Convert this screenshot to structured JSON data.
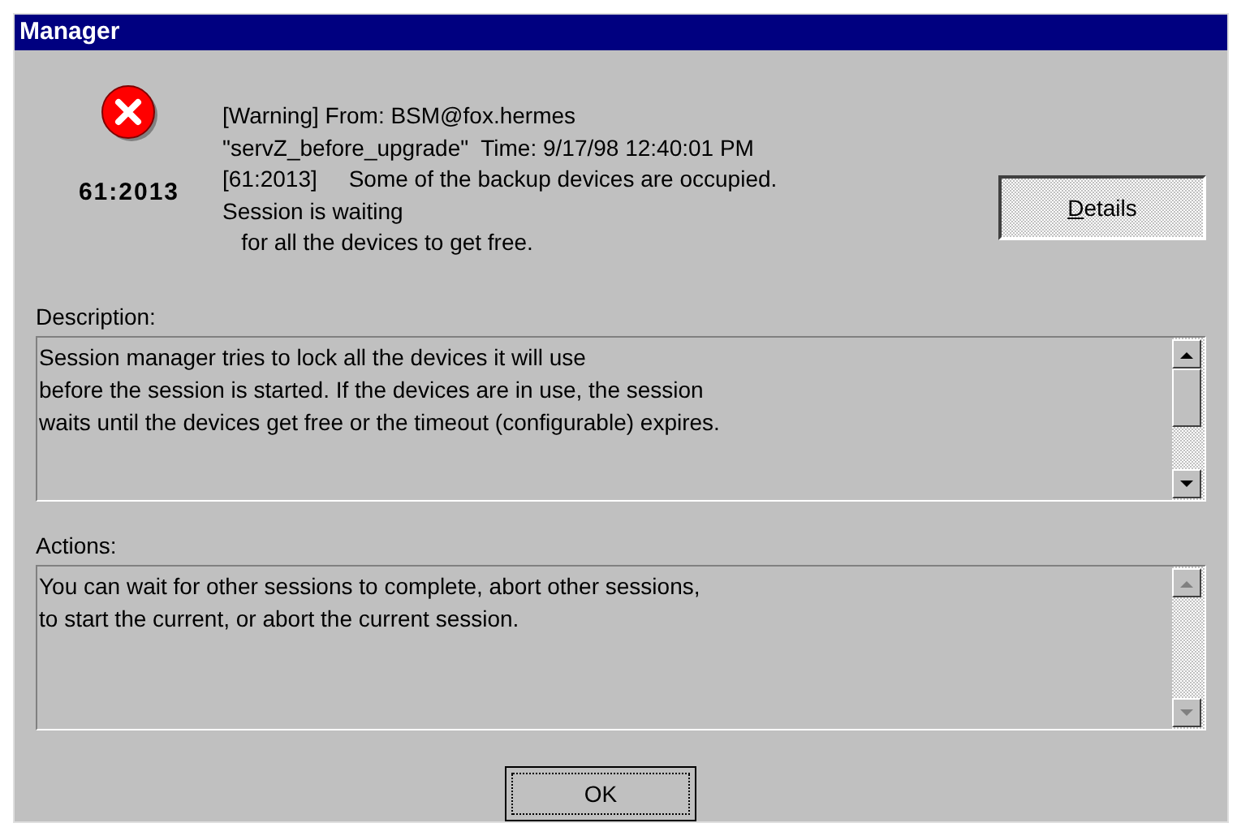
{
  "window": {
    "title": "Manager"
  },
  "error_code": "61:2013",
  "message_lines": [
    "[Warning] From: BSM@fox.hermes",
    "\"servZ_before_upgrade\"  Time: 9/17/98 12:40:01 PM",
    "[61:2013]     Some of the backup devices are occupied.",
    "Session is waiting",
    "   for all the devices to get free."
  ],
  "details_button": {
    "label": "Details"
  },
  "description": {
    "label": "Description:",
    "lines": [
      "Session manager tries to lock all the devices it will use",
      "before the session is started. If the devices are in use, the session",
      "waits until the devices get free or the timeout (configurable) expires."
    ],
    "scrollbar_disabled": false
  },
  "actions": {
    "label": "Actions:",
    "lines": [
      "You can wait for other sessions to complete, abort other sessions,",
      "to start the current, or abort the current session."
    ],
    "scrollbar_disabled": true
  },
  "ok_button": {
    "label": "OK"
  }
}
